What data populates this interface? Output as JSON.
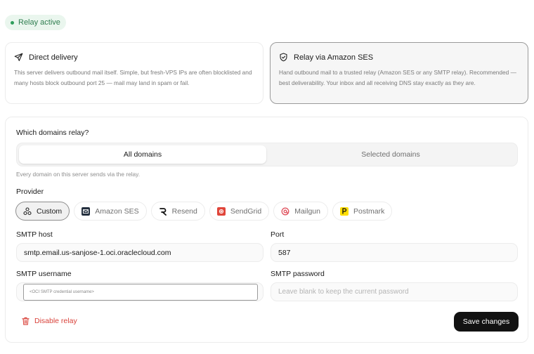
{
  "status_badge": {
    "label": "Relay active",
    "color": "#2f9d5c"
  },
  "delivery_options": [
    {
      "icon": "send-icon",
      "title": "Direct delivery",
      "description": "This server delivers outbound mail itself. Simple, but fresh-VPS IPs are often blocklisted and many hosts block outbound port 25 — mail may land in spam or fail.",
      "selected": false
    },
    {
      "icon": "shield-check-icon",
      "title": "Relay via Amazon SES",
      "description": "Hand outbound mail to a trusted relay (Amazon SES or any SMTP relay). Recommended — best deliverability. Your inbox and all receiving DNS stay exactly as they are.",
      "selected": true
    }
  ],
  "domains": {
    "label": "Which domains relay?",
    "options": [
      "All domains",
      "Selected domains"
    ],
    "selected": "All domains",
    "help": "Every domain on this server sends via the relay."
  },
  "provider": {
    "label": "Provider",
    "options": [
      {
        "name": "Custom",
        "icon": "custom-network-icon",
        "selected": true
      },
      {
        "name": "Amazon SES",
        "icon": "amazon-ses-icon",
        "selected": false
      },
      {
        "name": "Resend",
        "icon": "resend-icon",
        "selected": false
      },
      {
        "name": "SendGrid",
        "icon": "sendgrid-icon",
        "selected": false
      },
      {
        "name": "Mailgun",
        "icon": "mailgun-icon",
        "selected": false
      },
      {
        "name": "Postmark",
        "icon": "postmark-icon",
        "selected": false
      }
    ]
  },
  "smtp": {
    "host_label": "SMTP host",
    "host_value": "smtp.email.us-sanjose-1.oci.oraclecloud.com",
    "port_label": "Port",
    "port_value": "587",
    "username_label": "SMTP username",
    "username_value": "<OCI SMTP credential username>",
    "password_label": "SMTP password",
    "password_placeholder": "Leave blank to keep the current password"
  },
  "actions": {
    "disable_label": "Disable relay",
    "save_label": "Save changes"
  },
  "colors": {
    "danger": "#d9423a",
    "primary_button": "#121212",
    "amazon_ses": "#232f3e",
    "sendgrid": "#e0453a",
    "mailgun": "#e05560",
    "postmark": "#ffde00"
  }
}
